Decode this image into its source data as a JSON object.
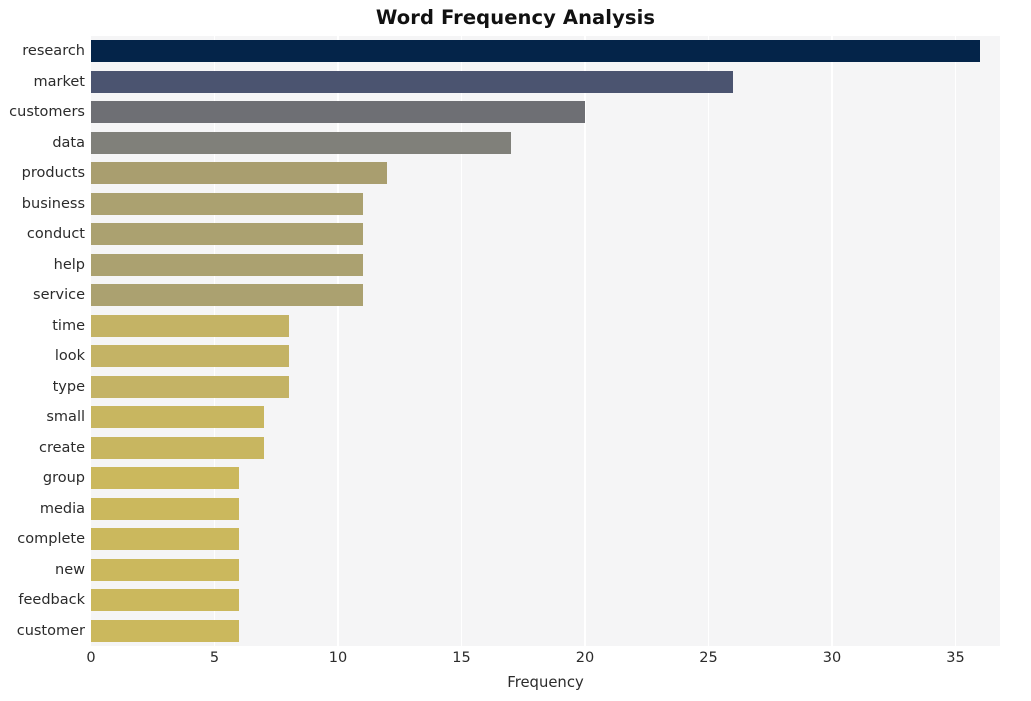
{
  "chart_data": {
    "type": "bar",
    "orientation": "horizontal",
    "title": "Word Frequency Analysis",
    "xlabel": "Frequency",
    "ylabel": "",
    "categories": [
      "research",
      "market",
      "customers",
      "data",
      "products",
      "business",
      "conduct",
      "help",
      "service",
      "time",
      "look",
      "type",
      "small",
      "create",
      "group",
      "media",
      "complete",
      "new",
      "feedback",
      "customer"
    ],
    "values": [
      36,
      26,
      20,
      17,
      12,
      11,
      11,
      11,
      11,
      8,
      8,
      8,
      7,
      7,
      6,
      6,
      6,
      6,
      6,
      6
    ],
    "bar_colors": [
      "#042449",
      "#4b5470",
      "#6e6f74",
      "#80807a",
      "#a99e6f",
      "#aba170",
      "#aba170",
      "#aba170",
      "#aba170",
      "#c4b365",
      "#c4b365",
      "#c4b365",
      "#c8b660",
      "#c8b660",
      "#cbb85d",
      "#cbb85d",
      "#cbb85d",
      "#cbb85d",
      "#cbb85d",
      "#cbb85d"
    ],
    "xlim": [
      0,
      36.8
    ],
    "xticks": [
      0,
      5,
      10,
      15,
      20,
      25,
      30,
      35
    ],
    "xticklabels": [
      "0",
      "5",
      "10",
      "15",
      "20",
      "25",
      "30",
      "35"
    ],
    "grid": true,
    "grid_axis": "x",
    "grid_color": "#ffffff",
    "plot_background": "#f5f5f6",
    "figure_background": "#ffffff",
    "legend": null,
    "colormap": "cividis"
  }
}
